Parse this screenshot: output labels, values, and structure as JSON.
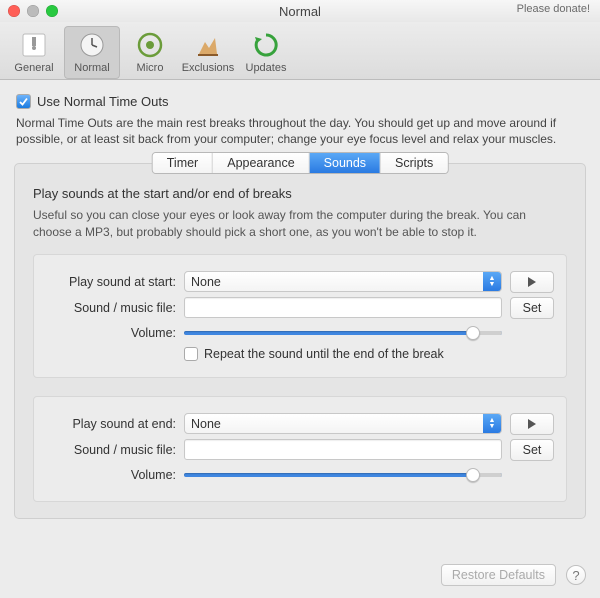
{
  "window": {
    "title": "Normal",
    "donate": "Please donate!"
  },
  "toolbar": {
    "general": "General",
    "normal": "Normal",
    "micro": "Micro",
    "exclusions": "Exclusions",
    "updates": "Updates"
  },
  "main": {
    "use_normal_label": "Use Normal Time Outs",
    "description": "Normal Time Outs are the main rest breaks throughout the day.  You should get up and move around if possible, or at least sit back from your computer; change your eye focus level and relax your muscles."
  },
  "tabs": {
    "timer": "Timer",
    "appearance": "Appearance",
    "sounds": "Sounds",
    "scripts": "Scripts"
  },
  "sounds": {
    "heading": "Play sounds at the start and/or end of breaks",
    "sub": "Useful so you can close your eyes or look away from the computer during the break.  You can choose a MP3, but probably should pick a short one, as you won't be able to stop it.",
    "start": {
      "play_label": "Play sound at start:",
      "select_value": "None",
      "file_label": "Sound / music file:",
      "file_value": "",
      "set_btn": "Set",
      "volume_label": "Volume:",
      "repeat_label": "Repeat the sound until the end of the break"
    },
    "end": {
      "play_label": "Play sound at end:",
      "select_value": "None",
      "file_label": "Sound / music file:",
      "file_value": "",
      "set_btn": "Set",
      "volume_label": "Volume:"
    }
  },
  "footer": {
    "restore": "Restore Defaults",
    "help": "?"
  }
}
